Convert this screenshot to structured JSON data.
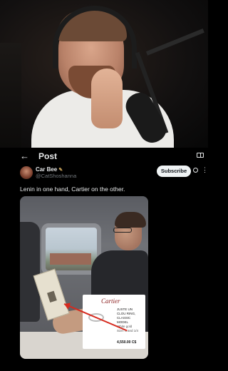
{
  "header": {
    "title": "Post"
  },
  "author": {
    "display_name": "Car Bee",
    "handle": "@CatShoshanna",
    "badge_icon": "pencil-icon"
  },
  "actions": {
    "subscribe_label": "Subscribe"
  },
  "post": {
    "text": "Lenin in one hand, Cartier on the other."
  },
  "media_overlay": {
    "brand": "Cartier",
    "product_lines": [
      "JUSTE UN",
      "CLOU RING,",
      "CLASSIC",
      "MODEL"
    ],
    "material": "White gold",
    "size_line": "Size: 6 and 1/4",
    "price": "4,550.00 C$"
  },
  "colors": {
    "background": "#000000",
    "text": "#e7e9ea",
    "muted": "#71767b",
    "button_bg": "#eff3f4",
    "arrow": "#d62a1e"
  }
}
